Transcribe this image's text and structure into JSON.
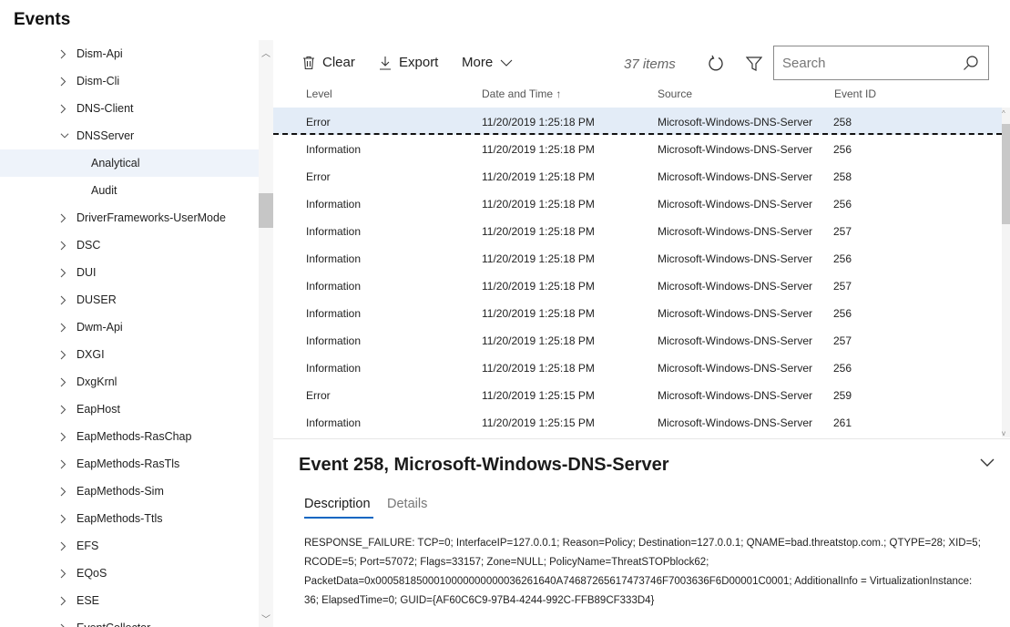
{
  "title": "Events",
  "tree": {
    "items": [
      {
        "label": "Dism-Api",
        "state": "collapsed",
        "level": 1
      },
      {
        "label": "Dism-Cli",
        "state": "collapsed",
        "level": 1
      },
      {
        "label": "DNS-Client",
        "state": "collapsed",
        "level": 1
      },
      {
        "label": "DNSServer",
        "state": "expanded",
        "level": 1
      },
      {
        "label": "Analytical",
        "state": "none",
        "level": 2,
        "selected": true
      },
      {
        "label": "Audit",
        "state": "none",
        "level": 2
      },
      {
        "label": "DriverFrameworks-UserMode",
        "state": "collapsed",
        "level": 1
      },
      {
        "label": "DSC",
        "state": "collapsed",
        "level": 1
      },
      {
        "label": "DUI",
        "state": "collapsed",
        "level": 1
      },
      {
        "label": "DUSER",
        "state": "collapsed",
        "level": 1
      },
      {
        "label": "Dwm-Api",
        "state": "collapsed",
        "level": 1
      },
      {
        "label": "DXGI",
        "state": "collapsed",
        "level": 1
      },
      {
        "label": "DxgKrnl",
        "state": "collapsed",
        "level": 1
      },
      {
        "label": "EapHost",
        "state": "collapsed",
        "level": 1
      },
      {
        "label": "EapMethods-RasChap",
        "state": "collapsed",
        "level": 1
      },
      {
        "label": "EapMethods-RasTls",
        "state": "collapsed",
        "level": 1
      },
      {
        "label": "EapMethods-Sim",
        "state": "collapsed",
        "level": 1
      },
      {
        "label": "EapMethods-Ttls",
        "state": "collapsed",
        "level": 1
      },
      {
        "label": "EFS",
        "state": "collapsed",
        "level": 1
      },
      {
        "label": "EQoS",
        "state": "collapsed",
        "level": 1
      },
      {
        "label": "ESE",
        "state": "collapsed",
        "level": 1
      },
      {
        "label": "EventCollector",
        "state": "collapsed",
        "level": 1
      }
    ]
  },
  "toolbar": {
    "clear_label": "Clear",
    "export_label": "Export",
    "more_label": "More",
    "item_count": "37 items",
    "refresh_icon": "refresh-icon",
    "filter_icon": "filter-icon",
    "search_placeholder": "Search"
  },
  "grid": {
    "columns": [
      "Level",
      "Date and Time",
      "Source",
      "Event ID"
    ],
    "sort_indicator": "↑",
    "rows": [
      {
        "level": "Error",
        "datetime": "11/20/2019 1:25:18 PM",
        "source": "Microsoft-Windows-DNS-Server",
        "event_id": "258",
        "selected": true
      },
      {
        "level": "Information",
        "datetime": "11/20/2019 1:25:18 PM",
        "source": "Microsoft-Windows-DNS-Server",
        "event_id": "256"
      },
      {
        "level": "Error",
        "datetime": "11/20/2019 1:25:18 PM",
        "source": "Microsoft-Windows-DNS-Server",
        "event_id": "258"
      },
      {
        "level": "Information",
        "datetime": "11/20/2019 1:25:18 PM",
        "source": "Microsoft-Windows-DNS-Server",
        "event_id": "256"
      },
      {
        "level": "Information",
        "datetime": "11/20/2019 1:25:18 PM",
        "source": "Microsoft-Windows-DNS-Server",
        "event_id": "257"
      },
      {
        "level": "Information",
        "datetime": "11/20/2019 1:25:18 PM",
        "source": "Microsoft-Windows-DNS-Server",
        "event_id": "256"
      },
      {
        "level": "Information",
        "datetime": "11/20/2019 1:25:18 PM",
        "source": "Microsoft-Windows-DNS-Server",
        "event_id": "257"
      },
      {
        "level": "Information",
        "datetime": "11/20/2019 1:25:18 PM",
        "source": "Microsoft-Windows-DNS-Server",
        "event_id": "256"
      },
      {
        "level": "Information",
        "datetime": "11/20/2019 1:25:18 PM",
        "source": "Microsoft-Windows-DNS-Server",
        "event_id": "257"
      },
      {
        "level": "Information",
        "datetime": "11/20/2019 1:25:18 PM",
        "source": "Microsoft-Windows-DNS-Server",
        "event_id": "256"
      },
      {
        "level": "Error",
        "datetime": "11/20/2019 1:25:15 PM",
        "source": "Microsoft-Windows-DNS-Server",
        "event_id": "259"
      },
      {
        "level": "Information",
        "datetime": "11/20/2019 1:25:15 PM",
        "source": "Microsoft-Windows-DNS-Server",
        "event_id": "261"
      }
    ]
  },
  "detail": {
    "title": "Event 258, Microsoft-Windows-DNS-Server",
    "tabs": [
      "Description",
      "Details"
    ],
    "active_tab": "Description",
    "description_lines": [
      "RESPONSE_FAILURE: TCP=0; InterfaceIP=127.0.0.1; Reason=Policy; Destination=127.0.0.1; QNAME=bad.threatstop.com.; QTYPE=28; XID=5;",
      "RCODE=5; Port=57072; Flags=33157; Zone=NULL; PolicyName=ThreatSTOPblock62;",
      "PacketData=0x0005818500010000000000036261640A74687265617473746F7003636F6D00001C0001; AdditionalInfo = VirtualizationInstance:",
      "36; ElapsedTime=0; GUID={AF60C6C9-97B4-4244-992C-FFB89CF333D4}"
    ]
  },
  "colors": {
    "accent": "#0a66c2",
    "selected_row": "#e3ecf7",
    "selected_tree": "#eef3fa"
  }
}
